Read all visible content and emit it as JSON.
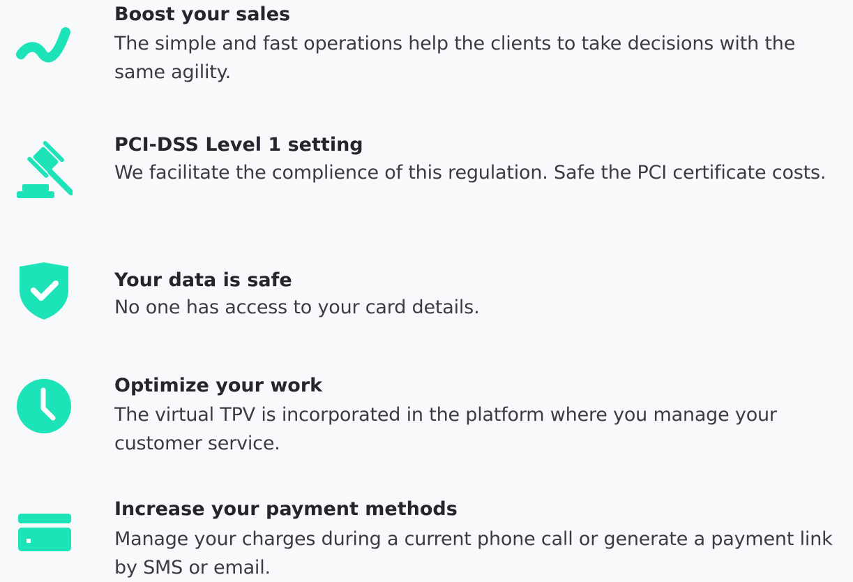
{
  "accent_color": "#1de3b9",
  "features": [
    {
      "icon": "trend-line-icon",
      "title": "Boost your sales",
      "description": "The simple and fast operations help the clients to take decisions with the same agility."
    },
    {
      "icon": "gavel-icon",
      "title": "PCI-DSS Level 1 setting",
      "description": "We facilitate the complience of this regulation. Safe the PCI certificate costs."
    },
    {
      "icon": "shield-check-icon",
      "title": "Your data is safe",
      "description": "No one has access to your card details."
    },
    {
      "icon": "clock-icon",
      "title": "Optimize your work",
      "description": "The virtual TPV is incorporated in the platform where you manage your customer service."
    },
    {
      "icon": "credit-card-icon",
      "title": "Increase your payment methods",
      "description": "Manage your charges during a current phone call or generate a payment link by SMS or email."
    }
  ]
}
